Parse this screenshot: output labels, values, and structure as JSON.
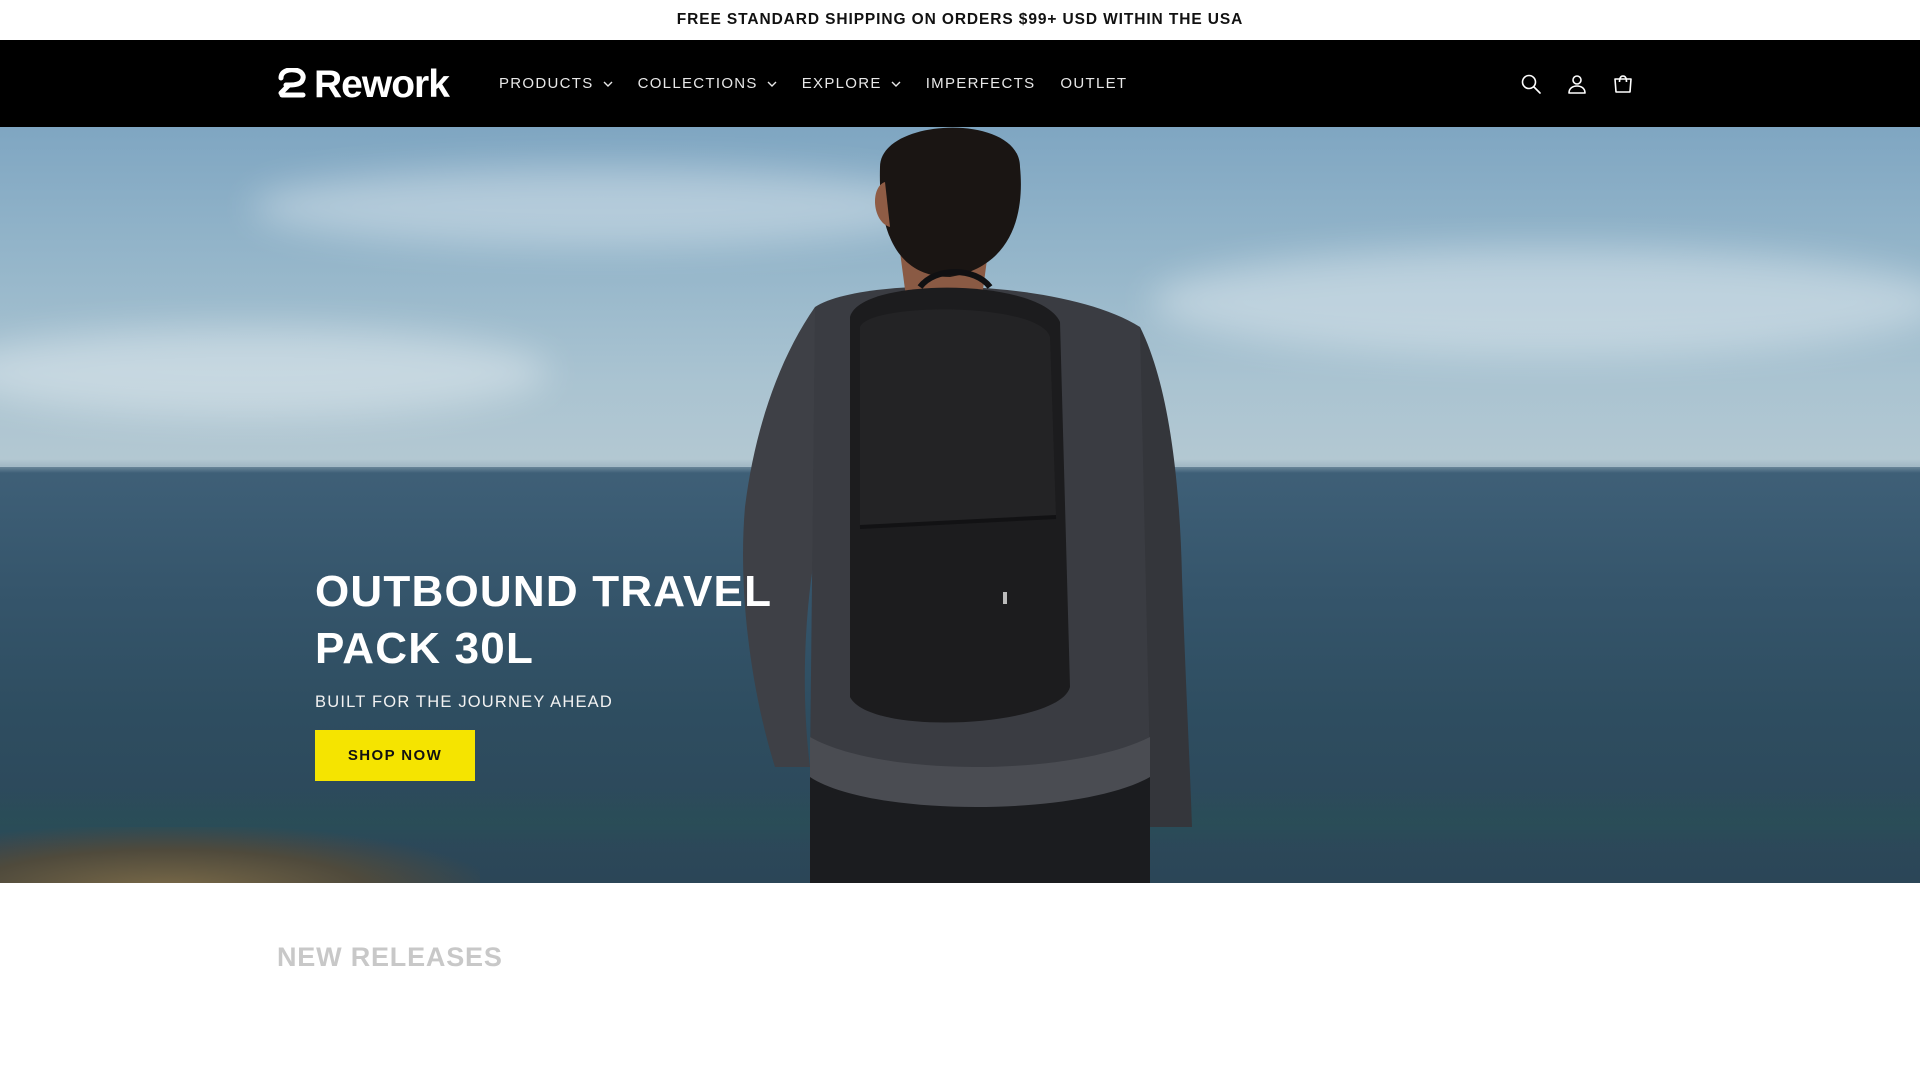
{
  "announcement": {
    "text": "FREE STANDARD SHIPPING ON ORDERS $99+ USD WITHIN THE USA"
  },
  "header": {
    "logo_text": "Rework",
    "nav": [
      {
        "label": "PRODUCTS",
        "has_dropdown": true
      },
      {
        "label": "COLLECTIONS",
        "has_dropdown": true
      },
      {
        "label": "EXPLORE",
        "has_dropdown": true
      },
      {
        "label": "IMPERFECTS",
        "has_dropdown": false
      },
      {
        "label": "OUTLET",
        "has_dropdown": false
      }
    ],
    "icons": [
      "search-icon",
      "account-icon",
      "cart-icon"
    ]
  },
  "hero": {
    "title_line1": "OUTBOUND TRAVEL",
    "title_line2": "PACK 30L",
    "subtitle": "BUILT FOR THE JOURNEY AHEAD",
    "cta_label": "SHOP NOW"
  },
  "new_releases": {
    "heading": "NEW RELEASES"
  },
  "colors": {
    "header_bg": "#000000",
    "cta_bg": "#f5e400",
    "announcement_text": "#111111",
    "section_heading": "#c8c8c8"
  }
}
